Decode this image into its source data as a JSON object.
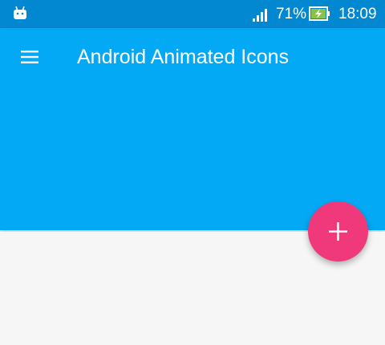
{
  "status_bar": {
    "notification_icon": "android-robot-icon",
    "signal_icon": "cell-signal-icon",
    "battery_percent": "71%",
    "battery_icon": "battery-charging-icon",
    "time": "18:09",
    "color": "#0288d1"
  },
  "app_bar": {
    "title": "Android Animated Icons",
    "menu_icon": "hamburger-menu-icon",
    "color": "#03a9f4"
  },
  "fab": {
    "icon": "plus-icon",
    "color": "#f0397b"
  }
}
